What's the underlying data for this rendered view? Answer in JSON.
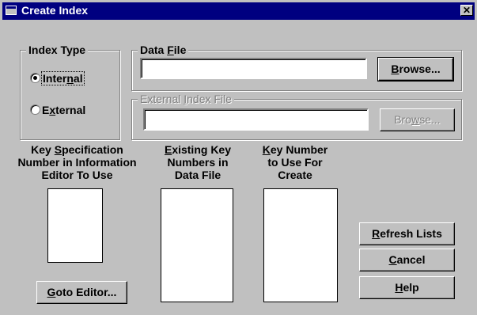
{
  "window": {
    "title": "Create Index",
    "close_glyph": "✕"
  },
  "index_type": {
    "legend": "Index Type",
    "internal": {
      "pre": "Inter",
      "key": "n",
      "post": "al"
    },
    "external": {
      "pre": "E",
      "key": "x",
      "post": "ternal"
    },
    "selected": "internal"
  },
  "data_file": {
    "legend_pre": "Data ",
    "legend_key": "F",
    "legend_post": "ile",
    "value": "",
    "browse": {
      "pre": "",
      "key": "B",
      "post": "rowse..."
    }
  },
  "external_index_file": {
    "legend_pre": "External ",
    "legend_key": "I",
    "legend_post": "ndex File",
    "value": "",
    "browse": {
      "pre": "Bro",
      "key": "w",
      "post": "se..."
    }
  },
  "columns": {
    "key_spec": {
      "l1_pre": "Key ",
      "l1_key": "S",
      "l1_post": "pecification",
      "l2": "Number in Information",
      "l3": "Editor To Use"
    },
    "existing": {
      "l1_pre": "",
      "l1_key": "E",
      "l1_post": "xisting Key",
      "l2": "Numbers in",
      "l3": "Data File"
    },
    "key_number": {
      "l1_pre": "",
      "l1_key": "K",
      "l1_post": "ey Number",
      "l2": "to Use For",
      "l3": "Create"
    }
  },
  "buttons": {
    "goto": {
      "pre": "",
      "key": "G",
      "post": "oto Editor..."
    },
    "refresh": {
      "pre": "",
      "key": "R",
      "post": "efresh Lists"
    },
    "cancel": {
      "pre": "",
      "key": "C",
      "post": "ancel"
    },
    "help": {
      "pre": "",
      "key": "H",
      "post": "elp"
    }
  }
}
